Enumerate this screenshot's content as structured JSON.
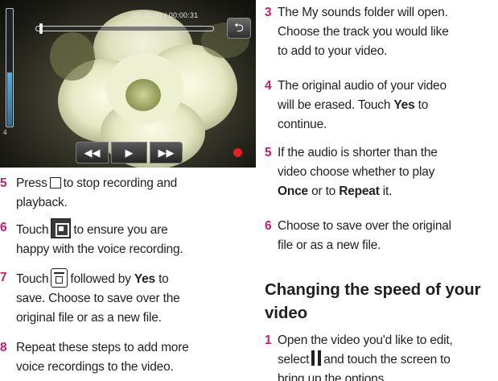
{
  "player": {
    "time": "00:00:00 / 00:00:31",
    "volume_level": "4",
    "volume_fraction": 0.45,
    "progress_fraction": 0.01,
    "icons": {
      "back": "return-arrow-icon",
      "rewind": "rewind-icon",
      "play": "play-icon",
      "forward": "fast-forward-icon",
      "record": "record-dot-icon",
      "stop": "stop-square-icon",
      "switch": "switch-view-icon",
      "save": "save-icon",
      "pause": "pause-icon"
    }
  },
  "accent_color": "#c41e6a",
  "left_steps": [
    {
      "num": "5",
      "line1a": "Press",
      "line1b": "to stop recording and",
      "line2": "playback."
    },
    {
      "num": "6",
      "line1a": "Touch",
      "line1b": "to ensure you are",
      "line2": "happy with the voice recording."
    },
    {
      "num": "7",
      "line1a": "Touch",
      "line1b": "followed by",
      "line1bold": "Yes",
      "line1c": "to",
      "line2": "save. Choose to save over the",
      "line3": "original file or as a new file."
    },
    {
      "num": "8",
      "line1": "Repeat these steps to add more",
      "line2": "voice recordings to the video."
    }
  ],
  "right_steps": [
    {
      "num": "3",
      "line1": "The My sounds folder will open.",
      "line2": "Choose the track you would like",
      "line3": "to add to your video."
    },
    {
      "num": "4",
      "line1": "The original audio of your video",
      "line2a": "will be erased. Touch",
      "line2bold": "Yes",
      "line2b": "to",
      "line3": "continue."
    },
    {
      "num": "5",
      "line1": "If the audio is shorter than the",
      "line2": "video choose whether to play",
      "line3bold1": "Once",
      "line3a": "or to",
      "line3bold2": "Repeat",
      "line3b": "it."
    },
    {
      "num": "6",
      "line1": "Choose to save over the original",
      "line2": "file or as a new file."
    }
  ],
  "section": {
    "heading_line1": "Changing the speed of your",
    "heading_line2": "video",
    "step_num": "1",
    "line1": "Open the video you'd like to edit,",
    "line2a": "select",
    "line2b": "and touch the screen to",
    "line3": "bring up the options."
  }
}
